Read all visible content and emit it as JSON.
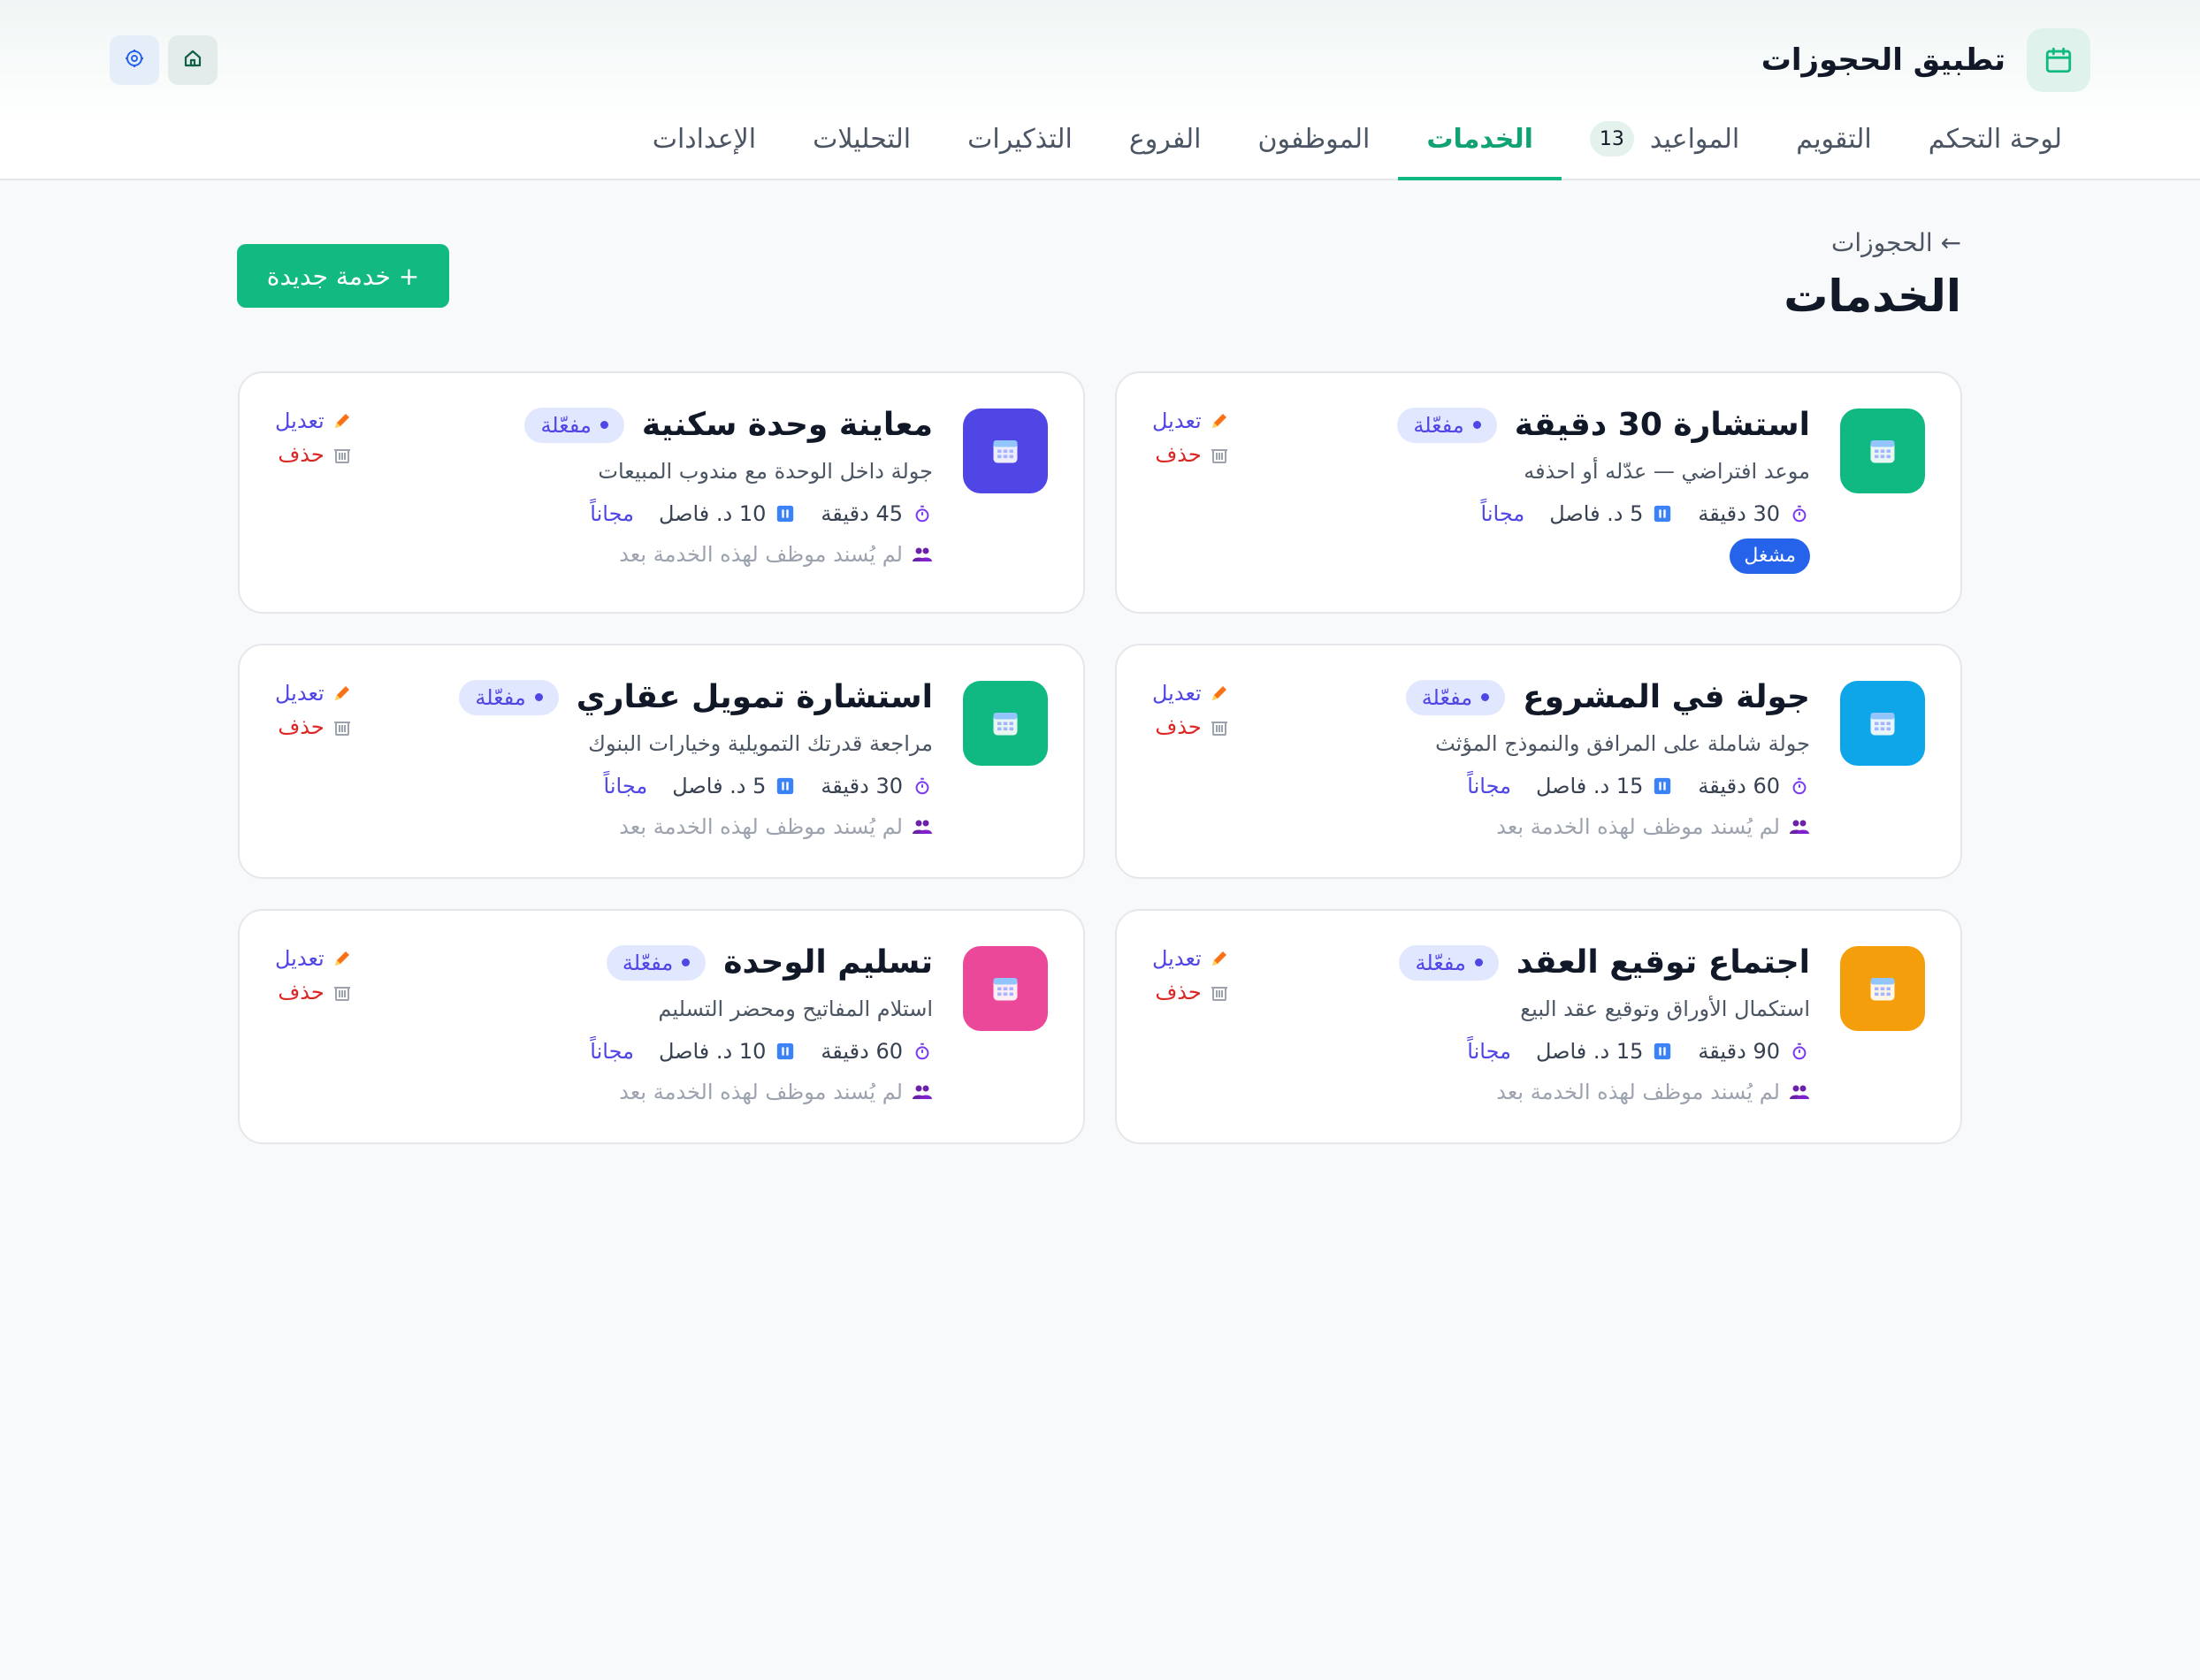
{
  "app": {
    "title": "تطبيق الحجوزات",
    "brand_color": "#10b981"
  },
  "nav": {
    "tabs": [
      {
        "label": "لوحة التحكم",
        "active": false
      },
      {
        "label": "التقويم",
        "active": false
      },
      {
        "label": "المواعيد",
        "active": false,
        "badge": "13"
      },
      {
        "label": "الخدمات",
        "active": true
      },
      {
        "label": "الموظفون",
        "active": false
      },
      {
        "label": "الفروع",
        "active": false
      },
      {
        "label": "التذكيرات",
        "active": false
      },
      {
        "label": "التحليلات",
        "active": false
      },
      {
        "label": "الإعدادات",
        "active": false
      }
    ]
  },
  "page": {
    "breadcrumb": "← الحجوزات",
    "title": "الخدمات",
    "new_button": "+ خدمة جديدة"
  },
  "services": [
    {
      "title": "استشارة 30 دقيقة",
      "status": "مفعّلة",
      "description": "موعد افتراضي — عدّله أو احذفه",
      "duration": "30 دقيقة",
      "gap": "5 د. فاصل",
      "price": "مجاناً",
      "badge": "مشغل",
      "color": "#10b981",
      "edit": "تعديل",
      "delete": "حذف"
    },
    {
      "title": "معاينة وحدة سكنية",
      "status": "مفعّلة",
      "description": "جولة داخل الوحدة مع مندوب المبيعات",
      "duration": "45 دقيقة",
      "gap": "10 د. فاصل",
      "price": "مجاناً",
      "staff": "لم يُسند موظف لهذه الخدمة بعد",
      "color": "#4f46e5",
      "edit": "تعديل",
      "delete": "حذف"
    },
    {
      "title": "جولة في المشروع",
      "status": "مفعّلة",
      "description": "جولة شاملة على المرافق والنموذج المؤثث",
      "duration": "60 دقيقة",
      "gap": "15 د. فاصل",
      "price": "مجاناً",
      "staff": "لم يُسند موظف لهذه الخدمة بعد",
      "color": "#0ea5e9",
      "edit": "تعديل",
      "delete": "حذف"
    },
    {
      "title": "استشارة تمويل عقاري",
      "status": "مفعّلة",
      "description": "مراجعة قدرتك التمويلية وخيارات البنوك",
      "duration": "30 دقيقة",
      "gap": "5 د. فاصل",
      "price": "مجاناً",
      "staff": "لم يُسند موظف لهذه الخدمة بعد",
      "color": "#10b981",
      "edit": "تعديل",
      "delete": "حذف"
    },
    {
      "title": "اجتماع توقيع العقد",
      "status": "مفعّلة",
      "description": "استكمال الأوراق وتوقيع عقد البيع",
      "duration": "90 دقيقة",
      "gap": "15 د. فاصل",
      "price": "مجاناً",
      "staff": "لم يُسند موظف لهذه الخدمة بعد",
      "color": "#f59e0b",
      "edit": "تعديل",
      "delete": "حذف"
    },
    {
      "title": "تسليم الوحدة",
      "status": "مفعّلة",
      "description": "استلام المفاتيح ومحضر التسليم",
      "duration": "60 دقيقة",
      "gap": "10 د. فاصل",
      "price": "مجاناً",
      "staff": "لم يُسند موظف لهذه الخدمة بعد",
      "color": "#ec4899",
      "edit": "تعديل",
      "delete": "حذف"
    }
  ]
}
